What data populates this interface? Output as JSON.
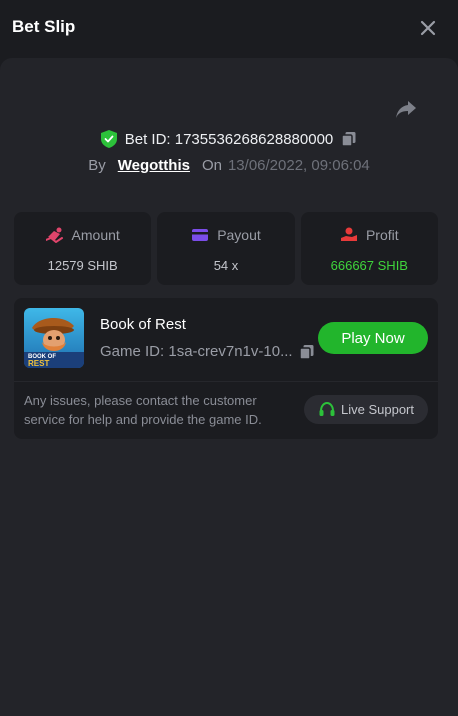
{
  "header": {
    "title": "Bet Slip",
    "close_icon": "close-icon"
  },
  "bet": {
    "id_text": "Bet ID: 1735536268628880000",
    "by_label": "By",
    "username": "Wegotthis",
    "on_label": "On",
    "datetime": "13/06/2022, 09:06:04"
  },
  "stats": [
    {
      "label": "Amount",
      "value": "12579 SHIB",
      "icon": "amount-icon",
      "color": "#e0446b"
    },
    {
      "label": "Payout",
      "value": "54 x",
      "icon": "payout-card-icon",
      "color": "#7b4de8"
    },
    {
      "label": "Profit",
      "value": "666667 SHIB",
      "icon": "profit-icon",
      "color": "#e83a3a",
      "value_color": "#3fd43c"
    }
  ],
  "game": {
    "name": "Book of Rest",
    "id_text": "Game ID: 1sa-crev7n1v-10...",
    "thumb_text_1": "BOOK OF",
    "thumb_text_2": "REST",
    "play_label": "Play Now",
    "notice": "Any issues, please contact the customer service for help and provide the game ID.",
    "support_label": "Live Support"
  },
  "colors": {
    "accent_green": "#22b52c",
    "verified_green": "#2cc13a"
  }
}
